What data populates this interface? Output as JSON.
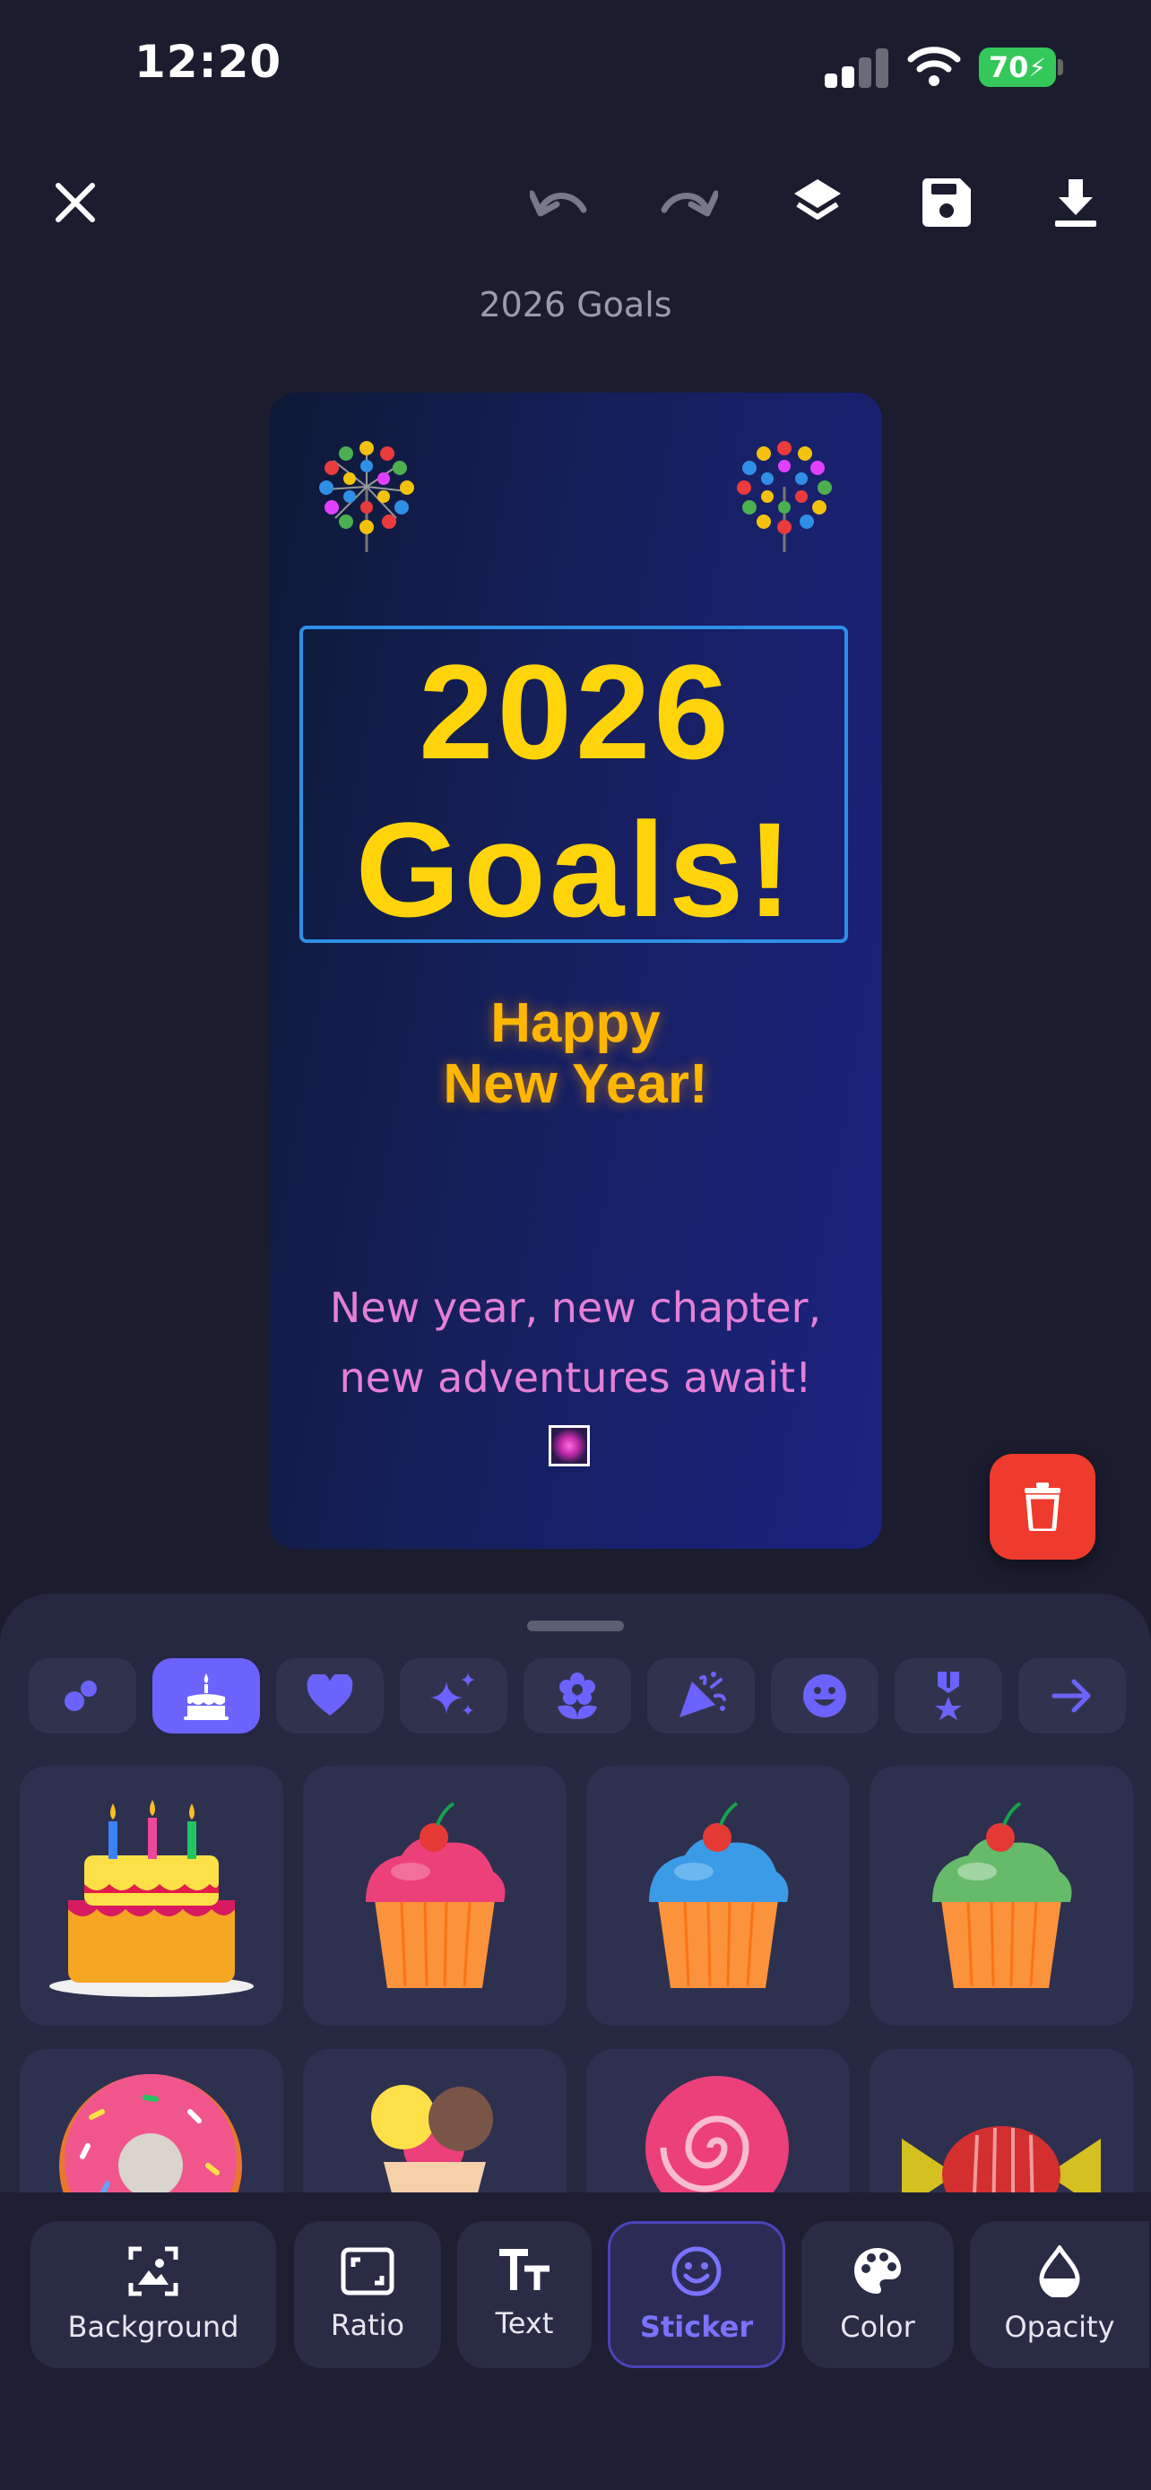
{
  "status": {
    "time": "12:20",
    "battery": "70"
  },
  "toolbar": {
    "title": "2026 Goals"
  },
  "card": {
    "headline_line1": "2026",
    "headline_line2": "Goals!",
    "sub_line1": "Happy",
    "sub_line2": "New Year!",
    "tagline_line1": "New year, new chapter,",
    "tagline_line2": "new adventures await!"
  },
  "categories": [
    {
      "icon": "bubbles-icon"
    },
    {
      "icon": "cake-icon",
      "active": true
    },
    {
      "icon": "heart-icon"
    },
    {
      "icon": "sparkles-icon"
    },
    {
      "icon": "flower-icon"
    },
    {
      "icon": "party-popper-icon"
    },
    {
      "icon": "smiley-icon"
    },
    {
      "icon": "medal-icon"
    },
    {
      "icon": "arrow-right-icon"
    }
  ],
  "bottom_tools": {
    "background": "Background",
    "ratio": "Ratio",
    "text": "Text",
    "sticker": "Sticker",
    "color": "Color",
    "opacity": "Opacity"
  },
  "colors": {
    "accent": "#6c63ff",
    "headline": "#ffd40a",
    "subheadline": "#ffb703",
    "tagline": "#e57fd6",
    "delete": "#ef3b2d"
  }
}
